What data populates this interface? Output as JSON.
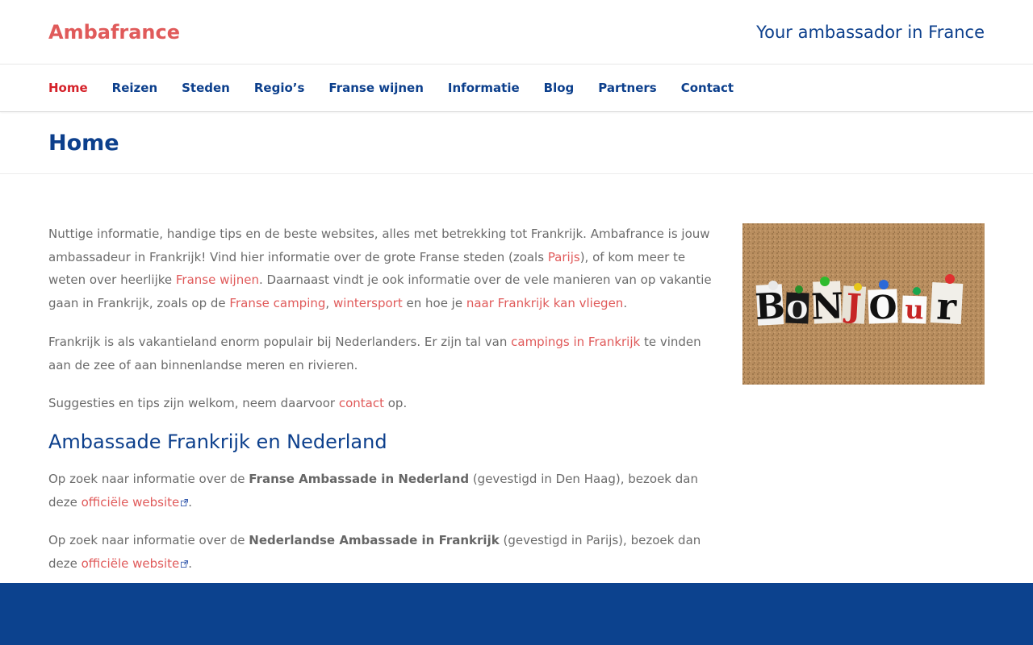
{
  "site": {
    "logo": "Ambafrance",
    "tagline": "Your ambassador in France"
  },
  "nav": {
    "items": [
      {
        "label": "Home",
        "active": true
      },
      {
        "label": "Reizen"
      },
      {
        "label": "Steden"
      },
      {
        "label": "Regio’s"
      },
      {
        "label": "Franse wijnen"
      },
      {
        "label": "Informatie"
      },
      {
        "label": "Blog"
      },
      {
        "label": "Partners"
      },
      {
        "label": "Contact"
      }
    ]
  },
  "page": {
    "title": "Home"
  },
  "intro": {
    "p1": {
      "t1": "Nuttige informatie, handige tips en de beste websites, alles met betrekking tot Frankrijk. Ambafrance is jouw ambassadeur in Frankrijk! Vind hier informatie over de grote Franse steden (zoals ",
      "l1": "Parijs",
      "t2": "), of kom meer te weten over heerlijke ",
      "l2": "Franse wijnen",
      "t3": ". Daarnaast vindt je ook informatie over de vele manieren van op vakantie gaan in Frankrijk, zoals op de ",
      "l3": "Franse camping",
      "t4": ", ",
      "l4": "wintersport",
      "t5": " en hoe je ",
      "l5": "naar Frankrijk kan vliegen",
      "t6": "."
    },
    "p2": {
      "t1": "Frankrijk is als vakantieland enorm populair bij Nederlanders. Er zijn tal van ",
      "l1": "campings in Frankrijk",
      "t2": " te vinden aan de zee of aan binnenlandse meren en rivieren."
    },
    "p3": {
      "t1": "Suggesties en tips zijn welkom, neem daarvoor ",
      "l1": "contact",
      "t2": " op."
    }
  },
  "embassy": {
    "heading": "Ambassade Frankrijk en Nederland",
    "p1": {
      "t1": "Op zoek naar informatie over de ",
      "b1": "Franse Ambassade in Nederland",
      "t2": " (gevestigd in Den Haag), bezoek dan deze ",
      "l1": "officiële website",
      "t3": "."
    },
    "p2": {
      "t1": "Op zoek naar informatie over de ",
      "b1": "Nederlandse Ambassade in Frankrijk",
      "t2": " (gevestigd in Parijs), bezoek dan deze ",
      "l1": "officiële website",
      "t3": "."
    }
  },
  "image": {
    "letters": "BONJOUR",
    "icon": "external-link-icon"
  },
  "colors": {
    "brand_red": "#e05a5a",
    "active_red": "#d5222a",
    "navy": "#0c3f8c",
    "footer": "#0c428e",
    "cork": "#b98e5f"
  }
}
